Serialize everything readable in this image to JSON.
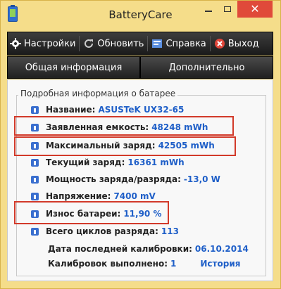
{
  "window": {
    "title": "BatteryCare",
    "icons": {
      "app": "battery-icon",
      "minimize": "minimize-icon",
      "maximize": "maximize-icon",
      "close": "close-icon"
    },
    "close_glyph": "✕"
  },
  "toolbar": {
    "items": [
      {
        "label": "Настройки",
        "icon": "gear-icon"
      },
      {
        "label": "Обновить",
        "icon": "refresh-icon"
      },
      {
        "label": "Справка",
        "icon": "help-icon"
      },
      {
        "label": "Выход",
        "icon": "exit-icon"
      }
    ]
  },
  "tabs": [
    {
      "label": "Общая информация"
    },
    {
      "label": "Дополнительно"
    }
  ],
  "details": {
    "group_title": "Подробная информация о батарее",
    "rows": [
      {
        "label": "Название:",
        "value": "ASUSTeK UX32-65"
      },
      {
        "label": "Заявленная емкость:",
        "value": "48248 mWh"
      },
      {
        "label": "Максимальный заряд:",
        "value": "42505 mWh"
      },
      {
        "label": "Текущий заряд:",
        "value": "16361 mWh"
      },
      {
        "label": "Мощность заряда/разряда:",
        "value": "-13,0 W"
      },
      {
        "label": "Напряжение:",
        "value": "7400 mV"
      },
      {
        "label": "Износ батареи:",
        "value": "11,90 %"
      },
      {
        "label": "Всего циклов разряда:",
        "value": "113"
      },
      {
        "label": "Дата последней калибровки:",
        "value": "06.10.2014"
      },
      {
        "label": "Калибровок выполнено:",
        "value": "1",
        "link": "История"
      }
    ]
  },
  "colors": {
    "highlight": "#d23a2a",
    "value": "#1f5fc8",
    "window": "#f5dd8a"
  }
}
